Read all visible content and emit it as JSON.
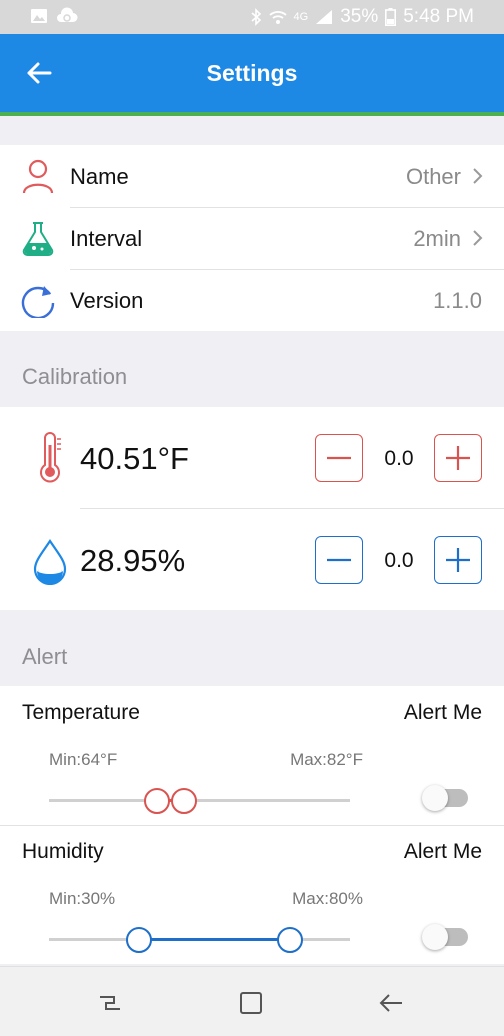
{
  "status_bar": {
    "network": "4G",
    "battery": "35%",
    "time": "5:48 PM"
  },
  "header": {
    "title": "Settings"
  },
  "info": [
    {
      "label": "Name",
      "value": "Other",
      "icon": "person-icon"
    },
    {
      "label": "Interval",
      "value": "2min",
      "icon": "flask-icon"
    },
    {
      "label": "Version",
      "value": "1.1.0",
      "icon": "refresh-icon"
    }
  ],
  "calibration": {
    "header": "Calibration",
    "temperature": {
      "reading": "40.51°F",
      "offset": "0.0",
      "icon": "thermometer-icon"
    },
    "humidity": {
      "reading": "28.95%",
      "offset": "0.0",
      "icon": "water-drop-icon"
    }
  },
  "alert": {
    "header": "Alert",
    "temperature": {
      "title": "Temperature",
      "alert_label": "Alert Me",
      "min_label": "Min:64°F",
      "max_label": "Max:82°F",
      "range_low_fraction": 0.36,
      "range_high_fraction": 0.45,
      "enabled": false
    },
    "humidity": {
      "title": "Humidity",
      "alert_label": "Alert Me",
      "min_label": "Min:30%",
      "max_label": "Max:80%",
      "range_low_fraction": 0.3,
      "range_high_fraction": 0.8,
      "enabled": false
    }
  },
  "colors": {
    "app_bar": "#1e88e5",
    "accent_green": "#4caf50",
    "temperature_red": "#d9534f",
    "humidity_blue": "#1e6fc9"
  }
}
